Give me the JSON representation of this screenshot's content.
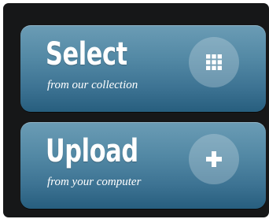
{
  "buttons": [
    {
      "title": "Select",
      "subtitle": "from our collection",
      "icon": "grid-icon"
    },
    {
      "title": "Upload",
      "subtitle": "from your computer",
      "icon": "plus-icon"
    }
  ],
  "colors": {
    "panel_background": "#161718",
    "button_top": "#6b9cb5",
    "button_bottom": "#275e7e",
    "text": "#ffffff"
  }
}
